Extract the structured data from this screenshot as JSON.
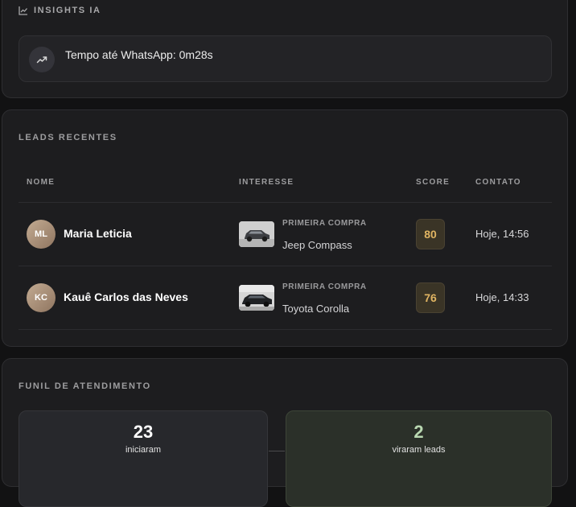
{
  "insights": {
    "title": "INSIGHTS IA",
    "items": [
      {
        "icon": "trending-up-icon",
        "text": "Tempo até WhatsApp: 0m28s"
      }
    ]
  },
  "leads": {
    "title": "LEADS RECENTES",
    "columns": {
      "name": "NOME",
      "interest": "INTERESSE",
      "score": "SCORE",
      "contact": "CONTATO"
    },
    "rows": [
      {
        "initials": "ML",
        "name": "Maria Leticia",
        "interest_type": "PRIMEIRA COMPRA",
        "car": "Jeep Compass",
        "score": "80",
        "contact": "Hoje, 14:56"
      },
      {
        "initials": "KC",
        "name": "Kauê Carlos das Neves",
        "interest_type": "PRIMEIRA COMPRA",
        "car": "Toyota Corolla",
        "score": "76",
        "contact": "Hoje, 14:33"
      }
    ]
  },
  "funnel": {
    "title": "FUNIL DE ATENDIMENTO",
    "stages": [
      {
        "value": "23",
        "label": "iniciaram"
      },
      {
        "value": "2",
        "label": "viraram leads"
      }
    ]
  },
  "colors": {
    "background": "#121213",
    "card": "#1d1d1f",
    "score_accent": "#e0b462",
    "leads_stage_accent": "#b9d8b1"
  }
}
